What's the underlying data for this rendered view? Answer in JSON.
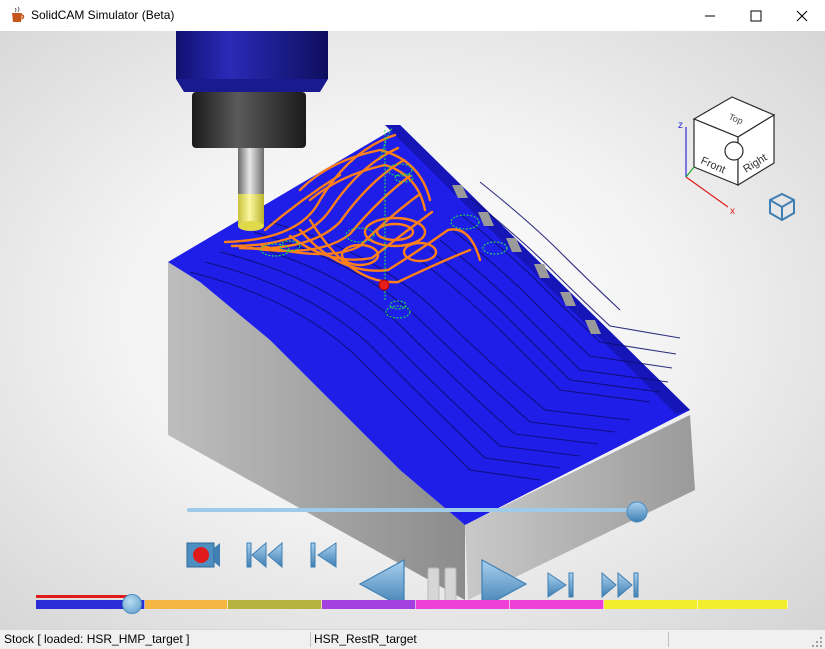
{
  "window": {
    "title": "SolidCAM Simulator (Beta)",
    "controls": [
      "minimize",
      "maximize",
      "close"
    ]
  },
  "colors": {
    "stock_blue": "#1e1ee8",
    "toolpath_orange": "#ff7f1a",
    "rapid_green": "#22dd55",
    "tool_holder_blue": "#1a1aa0",
    "tool_yellow": "#f5f06a",
    "control_blue": "#5b9bc8",
    "record_red": "#e11b1b"
  },
  "view_cube": {
    "faces": [
      "Top",
      "Front",
      "Right"
    ],
    "axes": [
      "z",
      "x"
    ]
  },
  "playback": {
    "buttons": [
      "record",
      "go-to-start",
      "step-back",
      "play-reverse",
      "pause",
      "play",
      "step-forward",
      "go-to-end"
    ],
    "speed_progress": 0.92,
    "timeline_progress": 0.13
  },
  "timeline_segments": [
    {
      "color": "#2b2bd8",
      "fraction": 0.145
    },
    {
      "color": "#f5b642",
      "fraction": 0.11
    },
    {
      "color": "#b8b33e",
      "fraction": 0.125
    },
    {
      "color": "#a43fe0",
      "fraction": 0.125
    },
    {
      "color": "#ee3fd6",
      "fraction": 0.125
    },
    {
      "color": "#ee3fd6",
      "fraction": 0.125
    },
    {
      "color": "#f2ee2e",
      "fraction": 0.125
    },
    {
      "color": "#f2ee2e",
      "fraction": 0.12
    }
  ],
  "status": {
    "stock_text": "Stock [ loaded:  HSR_HMP_target ]",
    "operation_text": "HSR_RestR_target"
  }
}
